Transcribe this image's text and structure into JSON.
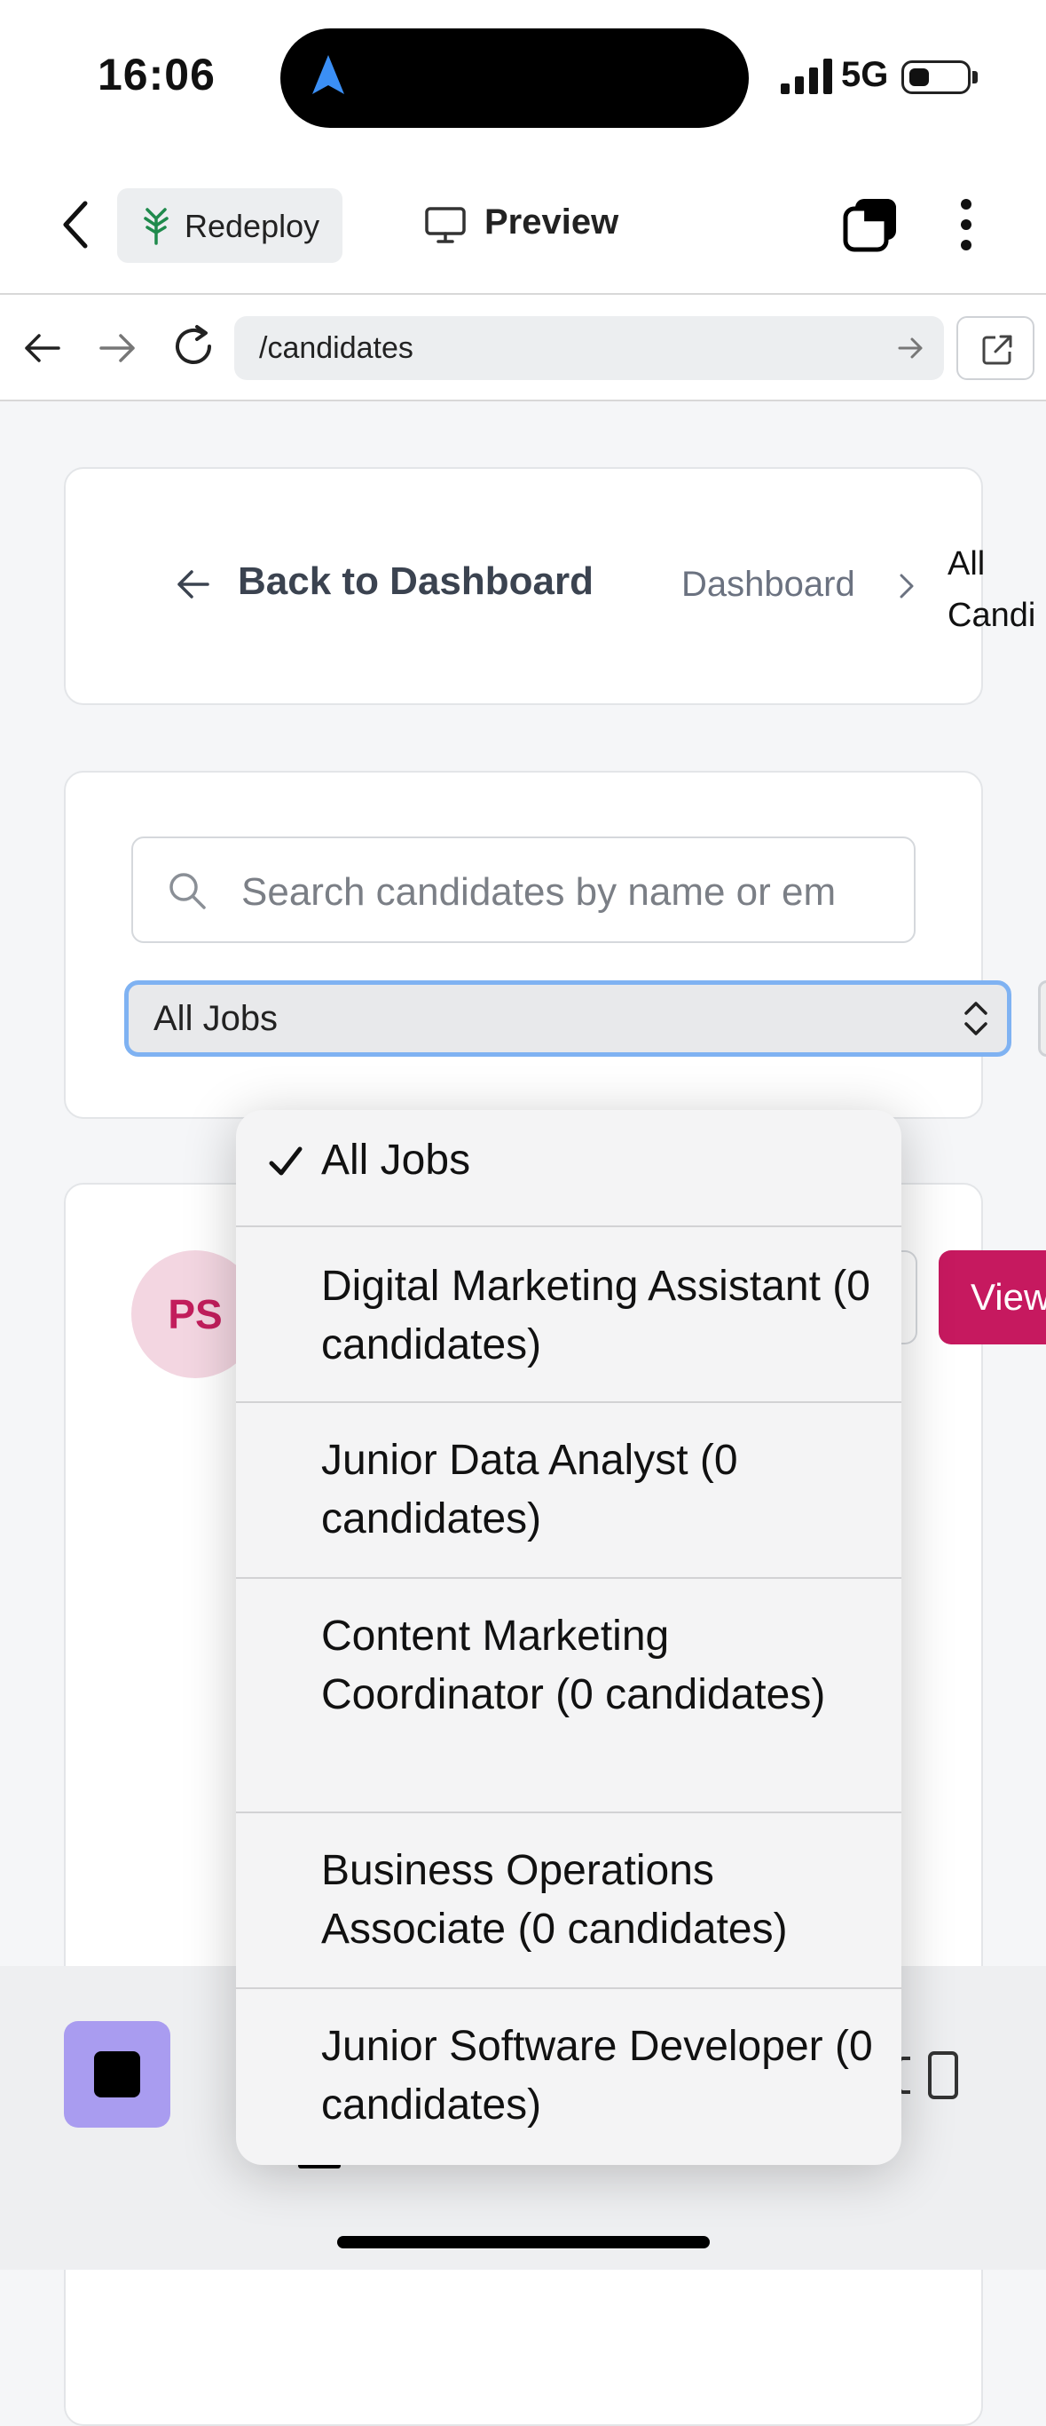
{
  "status_bar": {
    "time": "16:06",
    "network": "5G"
  },
  "toolbar": {
    "redeploy_label": "Redeploy",
    "preview_label": "Preview"
  },
  "browser": {
    "url": "/candidates"
  },
  "page": {
    "back_label": "Back to Dashboard",
    "breadcrumb": {
      "parent": "Dashboard",
      "current": "All\nCandi"
    },
    "search": {
      "placeholder": "Search candidates by name or em"
    },
    "job_filter": {
      "selected": "All Jobs",
      "options": [
        {
          "label": "All Jobs",
          "checked": true
        },
        {
          "label": "Digital Marketing Assistant (0 candidates)",
          "checked": false
        },
        {
          "label": "Junior Data Analyst (0 candidates)",
          "checked": false
        },
        {
          "label": "Content Marketing Coordinator (0 candidates)",
          "checked": false
        },
        {
          "label": "Business Operations Associate (0 candidates)",
          "checked": false
        },
        {
          "label": "Junior Software Developer (0 candidates)",
          "checked": false
        }
      ]
    },
    "candidate": {
      "initials": "PS",
      "view_label": "View"
    }
  },
  "colors": {
    "accent": "#c6195f",
    "focus_ring": "#7fb2f2",
    "stop_button": "#a99cf0"
  }
}
